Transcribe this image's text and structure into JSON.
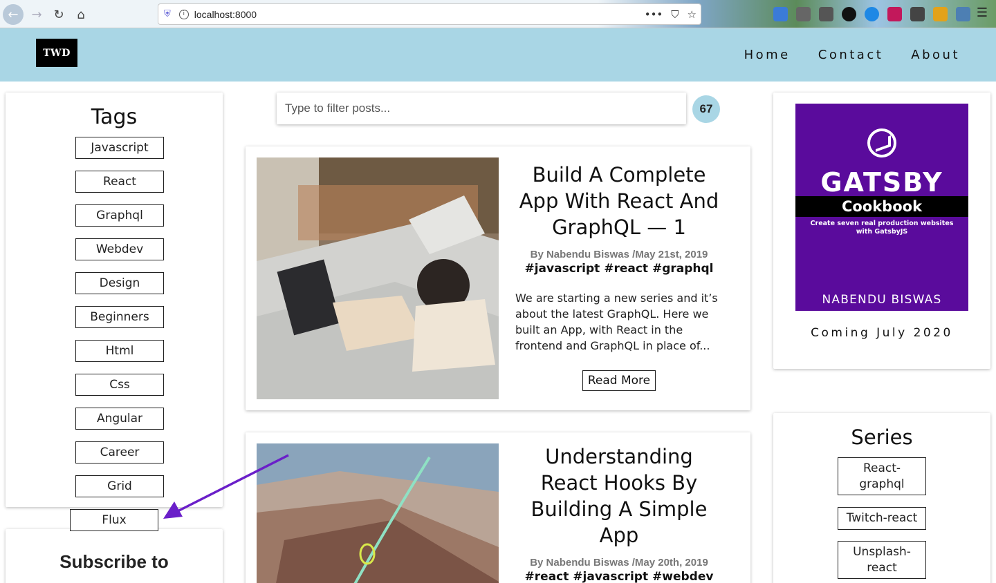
{
  "browser": {
    "url": "localhost:8000",
    "actions": [
      "•••",
      "⛉",
      "☆"
    ]
  },
  "header": {
    "logo_text": "TWD",
    "nav": [
      "Home",
      "Contact",
      "About"
    ],
    "bg_color": "#a9d6e5"
  },
  "tags": {
    "title": "Tags",
    "items": [
      "Javascript",
      "React",
      "Graphql",
      "Webdev",
      "Design",
      "Beginners",
      "Html",
      "Css",
      "Angular",
      "Career",
      "Grid",
      "Flux"
    ]
  },
  "subscribe": {
    "title": "Subscribe to"
  },
  "search": {
    "placeholder": "Type to filter posts...",
    "count": "67"
  },
  "posts": [
    {
      "title": "Build A Complete App With React And GraphQL — 1",
      "meta": "By Nabendu Biswas /May 21st, 2019",
      "tags": "#javascript #react #graphql",
      "excerpt": "We are starting a new series and it’s about the latest GraphQL. Here we built an App, with React in the frontend and GraphQL in place of...",
      "read_more": "Read More"
    },
    {
      "title": "Understanding React Hooks By Building A Simple App",
      "meta": "By Nabendu Biswas /May 20th, 2019",
      "tags": "#react #javascript #webdev"
    }
  ],
  "book": {
    "title": "GATSBY",
    "band": "Cookbook",
    "subtitle": "Create seven real production websites with GatsbyJS",
    "author": "NABENDU BISWAS",
    "coming": "Coming July 2020",
    "cover_color": "#5a0b9c"
  },
  "series": {
    "title": "Series",
    "items": [
      "React-graphql",
      "Twitch-react",
      "Unsplash-react"
    ]
  },
  "annotation": {
    "arrow_color": "#6a1fc9"
  }
}
